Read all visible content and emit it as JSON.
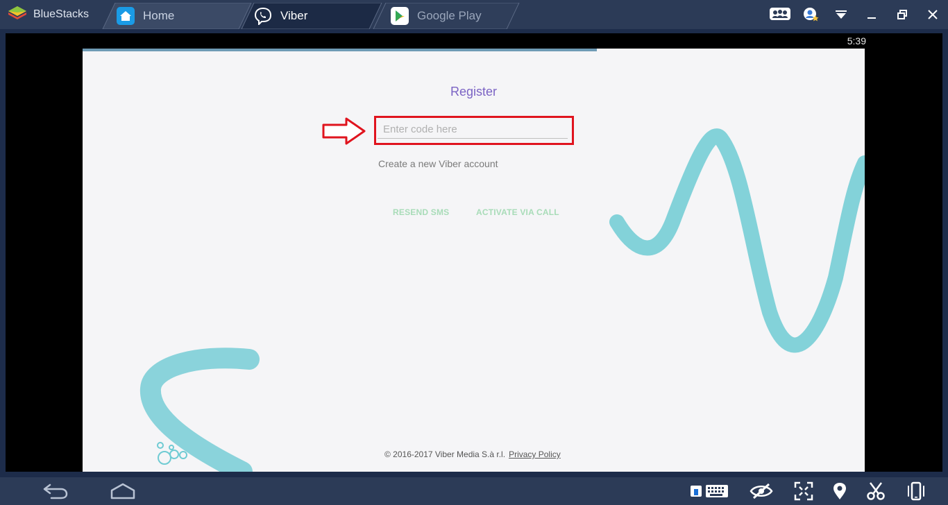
{
  "titlebar": {
    "brand": "BlueStacks",
    "tabs": [
      {
        "label": "Home"
      },
      {
        "label": "Viber"
      },
      {
        "label": "Google Play"
      }
    ]
  },
  "android": {
    "status_time": "5:39"
  },
  "register": {
    "title": "Register",
    "code_placeholder": "Enter code here",
    "create_account": "Create a new Viber account",
    "resend_sms": "RESEND SMS",
    "activate_via_call": "ACTIVATE VIA CALL",
    "copyright": "© 2016-2017 Viber Media S.à r.l.",
    "privacy_policy": "Privacy Policy"
  },
  "colors": {
    "title_purple": "#7b63c4",
    "action_green": "#a8dcb8",
    "wave_teal": "#6fcbd3",
    "highlight_red": "#e0141e"
  }
}
